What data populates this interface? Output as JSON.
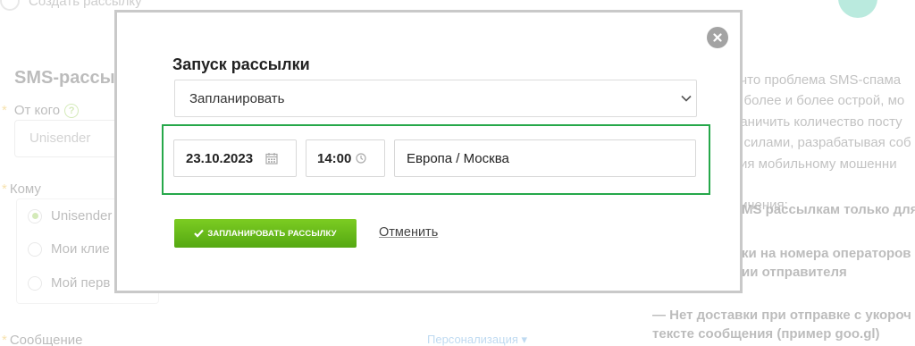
{
  "background": {
    "top_create_label": "Создать рассылку",
    "section_title": "SMS-рассы",
    "from_label": "От кого",
    "from_help": "?",
    "from_value": "Unisender",
    "to_label": "Кому",
    "recipients": [
      {
        "label": "Unisender",
        "selected": true
      },
      {
        "label": "Мои клие",
        "selected": false
      },
      {
        "label": "Мой перв",
        "selected": false
      }
    ],
    "message_label": "Сообщение",
    "personalization_link": "Персонализация",
    "right_text_lines": [
      ", что проблема SMS-спама",
      "е более и более острой, мо",
      "раничить количество посту",
      "и силами, разрабатывая соб",
      "вия мобильному мошенни",
      "",
      "ничения:"
    ],
    "right_bold_1": "MS рассылкам только для",
    "right_bold_2_lines": [
      "ки на номера операторов",
      "ии отправителя"
    ],
    "right_bold_3_lines": [
      "— Нет доставки при отправке с укороч",
      "тексте сообщения (пример goo.gl)"
    ]
  },
  "modal": {
    "title": "Запуск рассылки",
    "mode_select": "Запланировать",
    "date": "23.10.2023",
    "time": "14:00",
    "timezone": "Европа / Москва",
    "schedule_button": "ЗАПЛАНИРОВАТЬ РАССЫЛКУ",
    "cancel_link": "Отменить"
  },
  "colors": {
    "accent_green": "#5cb517",
    "highlight_green": "#26a84a",
    "close_grey": "#a3a3a3"
  },
  "icons": {
    "close": "close-icon",
    "chevron": "chevron-down-icon",
    "calendar": "calendar-icon",
    "clock": "clock-icon",
    "check": "check-icon"
  }
}
